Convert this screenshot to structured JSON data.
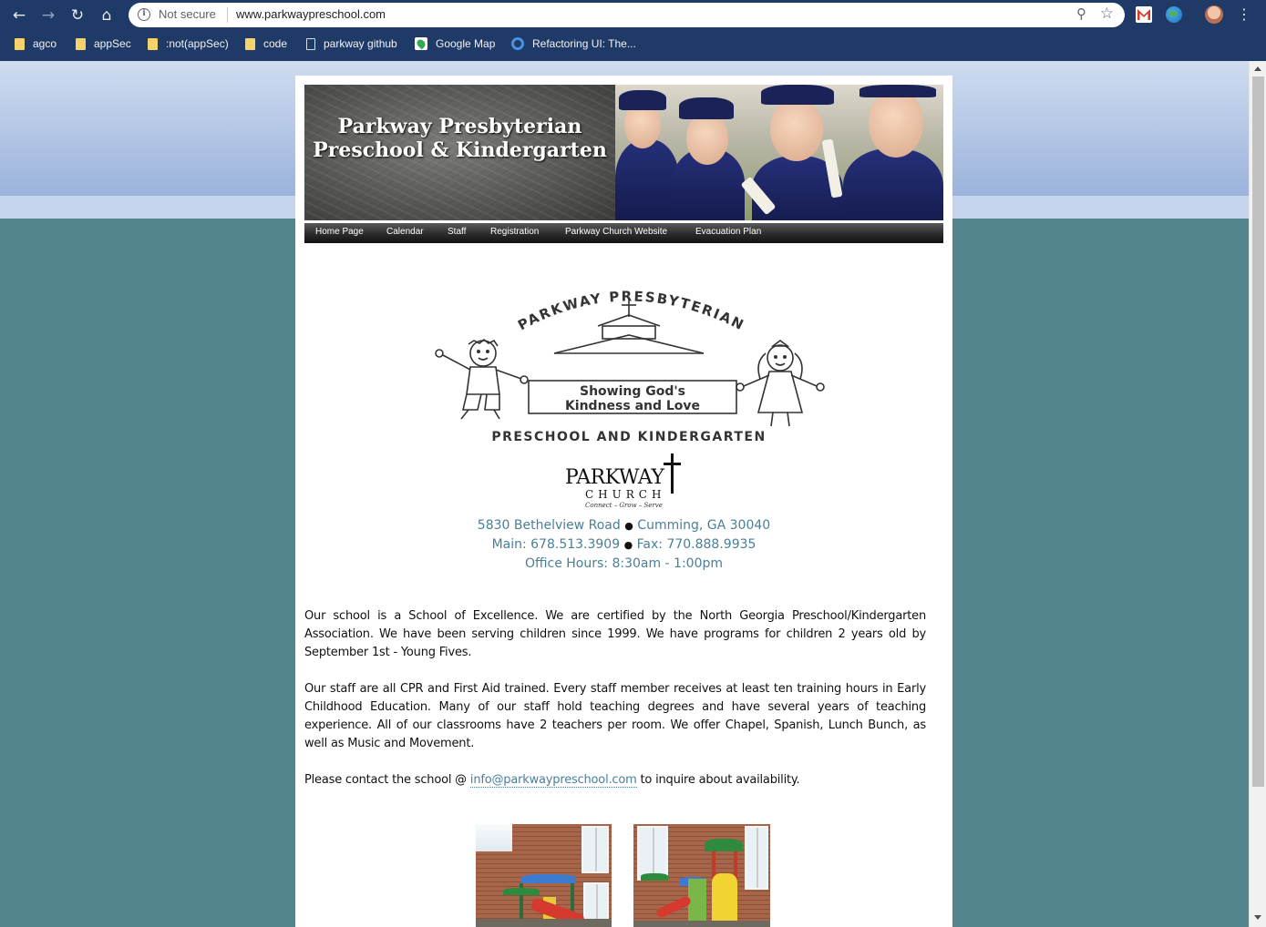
{
  "browser": {
    "security_label": "Not secure",
    "url": "www.parkwaypreschool.com",
    "bookmarks": [
      {
        "label": "agco",
        "icon": "folder-icon"
      },
      {
        "label": "appSec",
        "icon": "folder-icon"
      },
      {
        "label": ":not(appSec)",
        "icon": "folder-icon"
      },
      {
        "label": "code",
        "icon": "folder-icon"
      },
      {
        "label": "parkway github",
        "icon": "page-icon"
      },
      {
        "label": "Google Map",
        "icon": "google-maps-icon"
      },
      {
        "label": "Refactoring UI: The...",
        "icon": "ring-icon"
      }
    ]
  },
  "header": {
    "title_line1": "Parkway Presbyterian",
    "title_line2": "Preschool & Kindergarten"
  },
  "nav": [
    "Home Page",
    "Calendar",
    "Staff",
    "Registration",
    "Parkway Church Website",
    "Evacuation Plan"
  ],
  "school_logo": {
    "arc_text": "PARKWAY PRESBYTERIAN",
    "sign_line1": "Showing God's",
    "sign_line2": "Kindness and Love",
    "bottom_text": "PRESCHOOL AND KINDERGARTEN"
  },
  "church_logo": {
    "name": "PARKWAY",
    "word": "CHURCH",
    "tagline": "Connect – Grow – Serve"
  },
  "contact": {
    "address": "5830 Bethelview Road",
    "city": "Cumming, GA 30040",
    "main": "Main: 678.513.3909",
    "fax": "Fax: 770.888.9935",
    "hours": "Office Hours: 8:30am - 1:00pm",
    "bullet": "●"
  },
  "content": {
    "para1": "Our school is a School of Excellence. We are certified by the North Georgia Preschool/Kindergarten Association. We have been serving children since 1999. We have programs for children 2 years old by September 1st - Young Fives.",
    "para2": "Our staff are all CPR and First Aid trained. Every staff member receives at least ten training hours in Early Childhood Education. Many of our staff hold teaching degrees and have several years of teaching experience. All of our classrooms have 2 teachers per room. We offer Chapel, Spanish, Lunch Bunch, as well as Music and Movement.",
    "para3_before": "Please contact the school @ ",
    "email": "info@parkwaypreschool.com",
    "para3_after": " to inquire about availability."
  },
  "colors": {
    "page_background": "#53858f",
    "header_gradient_top": "#cfdcf0",
    "browser_chrome": "#1f3a66",
    "contact_text": "#4a7f99",
    "link": "#4a7f99"
  }
}
